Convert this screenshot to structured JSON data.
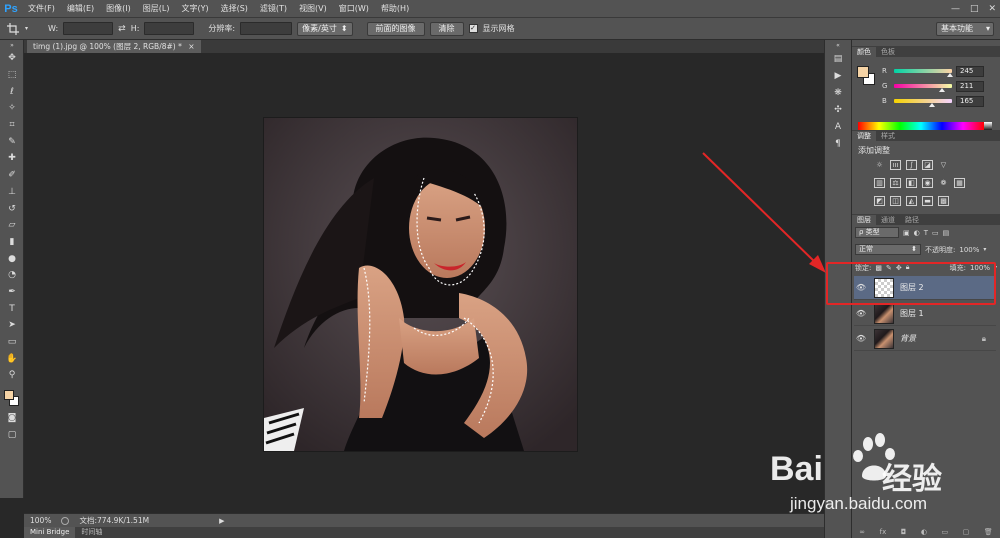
{
  "menubar": {
    "logo": "Ps",
    "items": [
      "文件(F)",
      "编辑(E)",
      "图像(I)",
      "图层(L)",
      "文字(Y)",
      "选择(S)",
      "滤镜(T)",
      "视图(V)",
      "窗口(W)",
      "帮助(H)"
    ],
    "win_minimize": "—",
    "win_maximize": "□",
    "win_close": "✕"
  },
  "options": {
    "w_label": "W:",
    "h_label": "H:",
    "resolution_label": "分辨率:",
    "unit_select": "像素/英寸",
    "front_image_button": "前面的图像",
    "clear_button": "清除",
    "show_grid_label": "显示网格",
    "show_grid_checked": "✓",
    "workspace": "基本功能"
  },
  "document": {
    "tab_title": "timg (1).jpg @ 100% (图层 2, RGB/8#) *",
    "tab_close": "×"
  },
  "status": {
    "zoom": "100%",
    "doc_size": "文档:774.9K/1.51M"
  },
  "bottom_tabs": [
    "Mini Bridge",
    "时间轴"
  ],
  "color_panel": {
    "tabs": [
      "颜色",
      "色板"
    ],
    "r_label": "R",
    "g_label": "G",
    "b_label": "B",
    "r": "245",
    "g": "211",
    "b": "165",
    "r_value": 245,
    "g_value": 211,
    "b_value": 165,
    "foreground": "#f5d3a5",
    "background": "#ffffff"
  },
  "adjustments_panel": {
    "tabs": [
      "调整",
      "样式"
    ],
    "title": "添加调整"
  },
  "layers_panel": {
    "tabs": [
      "图层",
      "通道",
      "路径"
    ],
    "filter_kind": "ρ 类型",
    "blend_mode": "正常",
    "opacity_label": "不透明度:",
    "opacity": "100%",
    "lock_label": "锁定:",
    "fill_label": "填充:",
    "fill": "100%",
    "layers": [
      {
        "name": "图层 2",
        "selected": true,
        "thumb": "transparent"
      },
      {
        "name": "图层 1",
        "selected": false,
        "thumb": "photo"
      },
      {
        "name": "背景",
        "selected": false,
        "thumb": "photo",
        "locked": true
      }
    ]
  },
  "watermark": {
    "brand_cn": "经验",
    "brand_en": "Bai",
    "url": "jingyan.baidu.com"
  },
  "colors": {
    "highlight_box": "#e32626",
    "selected_layer": "#5b6a85"
  }
}
